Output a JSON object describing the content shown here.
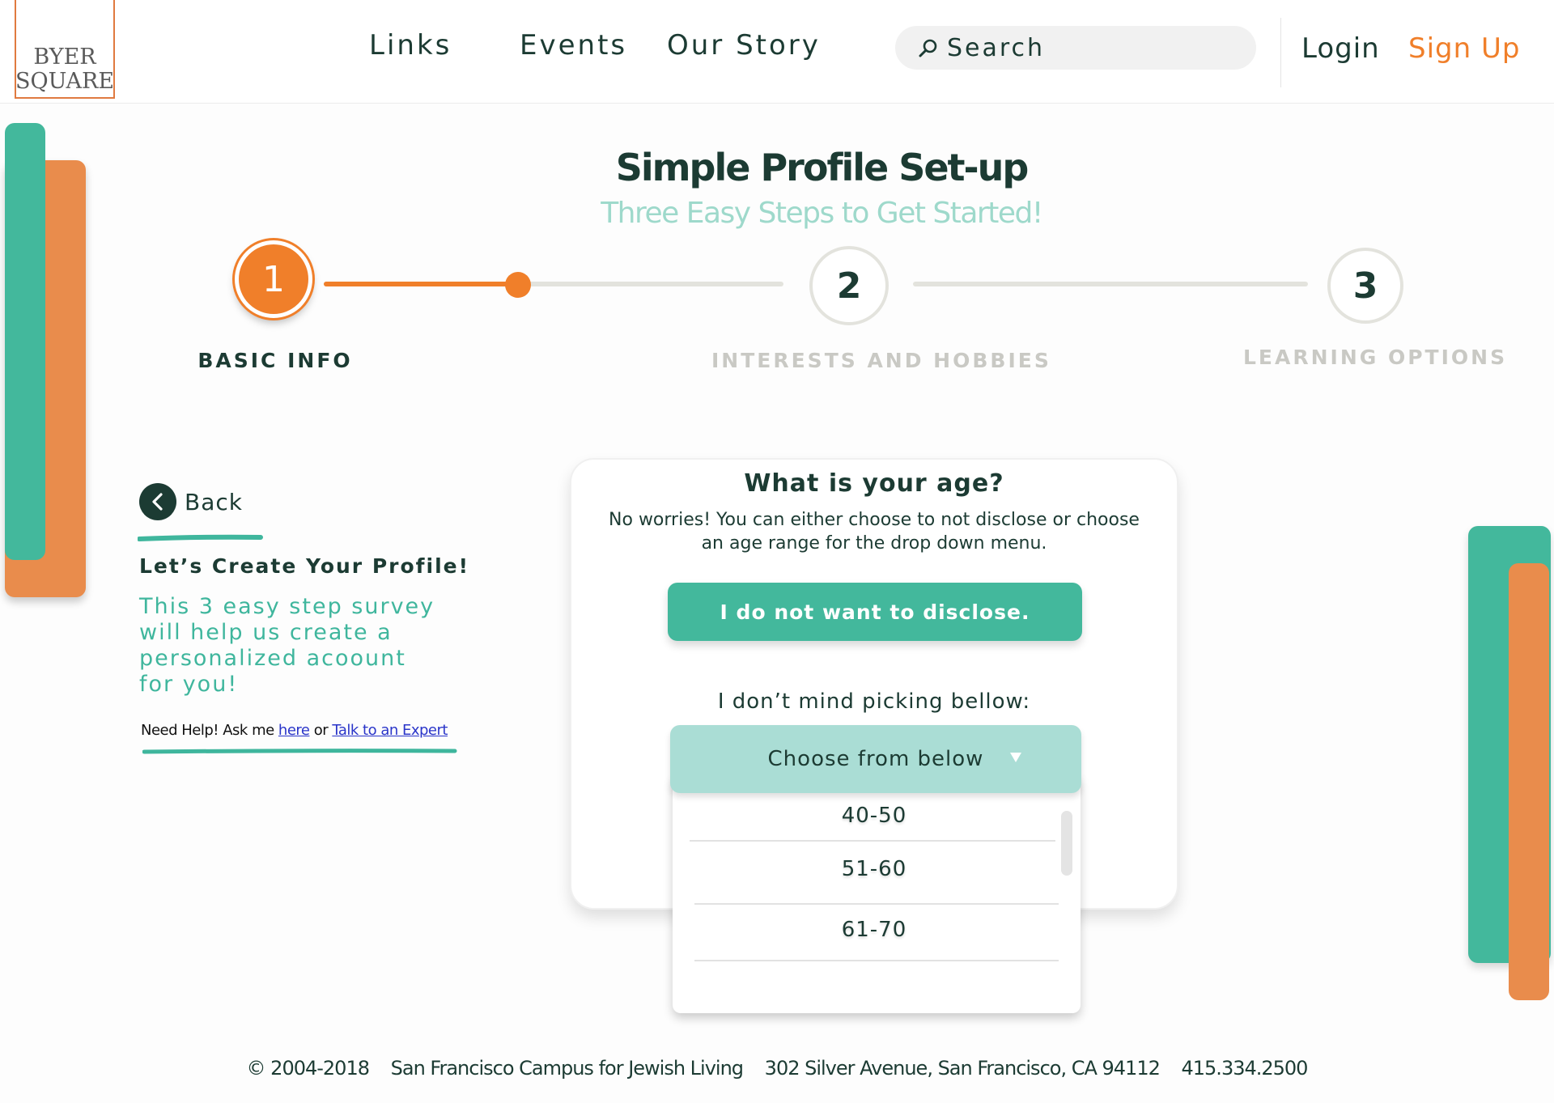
{
  "header": {
    "logo_line1": "BYER",
    "logo_line2": "SQUARE",
    "nav": [
      "Links",
      "Events",
      "Our Story"
    ],
    "search_placeholder": "Search",
    "login": "Login",
    "signup": "Sign Up"
  },
  "page": {
    "title": "Simple Profile Set-up",
    "subtitle": "Three Easy Steps to Get Started!"
  },
  "steps": [
    {
      "number": "1",
      "label": "BASIC INFO",
      "state": "active"
    },
    {
      "number": "2",
      "label": "INTERESTS AND HOBBIES",
      "state": "upcoming"
    },
    {
      "number": "3",
      "label": "LEARNING OPTIONS",
      "state": "upcoming"
    }
  ],
  "left": {
    "back": "Back",
    "heading": "Let’s Create Your Profile!",
    "description": "This 3 easy step survey will help us create a personalized acoount for you!",
    "help_prefix": "Need Help! Ask me ",
    "help_link1": "here",
    "help_mid": " or ",
    "help_link2": "Talk to an Expert"
  },
  "card": {
    "title": "What is your age?",
    "description": "No worries! You can either choose to not disclose or choose an age range for the drop down menu.",
    "disclose_button": "I do not want to disclose.",
    "pick_label": "I don’t mind picking bellow:",
    "dropdown_placeholder": "Choose from below",
    "options": [
      "40-50",
      "51-60",
      "61-70"
    ]
  },
  "footer": {
    "copyright": "© 2004-2018",
    "org": "San Francisco Campus for Jewish Living",
    "address": "302 Silver Avenue, San Francisco, CA 94112",
    "phone": "415.334.2500"
  },
  "colors": {
    "dark_green": "#1c3b33",
    "teal": "#43b89c",
    "light_teal": "#aaddd5",
    "orange": "#f07f2a"
  },
  "icons": {
    "search": "search-icon",
    "back": "chevron-left-icon",
    "dropdown": "caret-down-icon"
  }
}
